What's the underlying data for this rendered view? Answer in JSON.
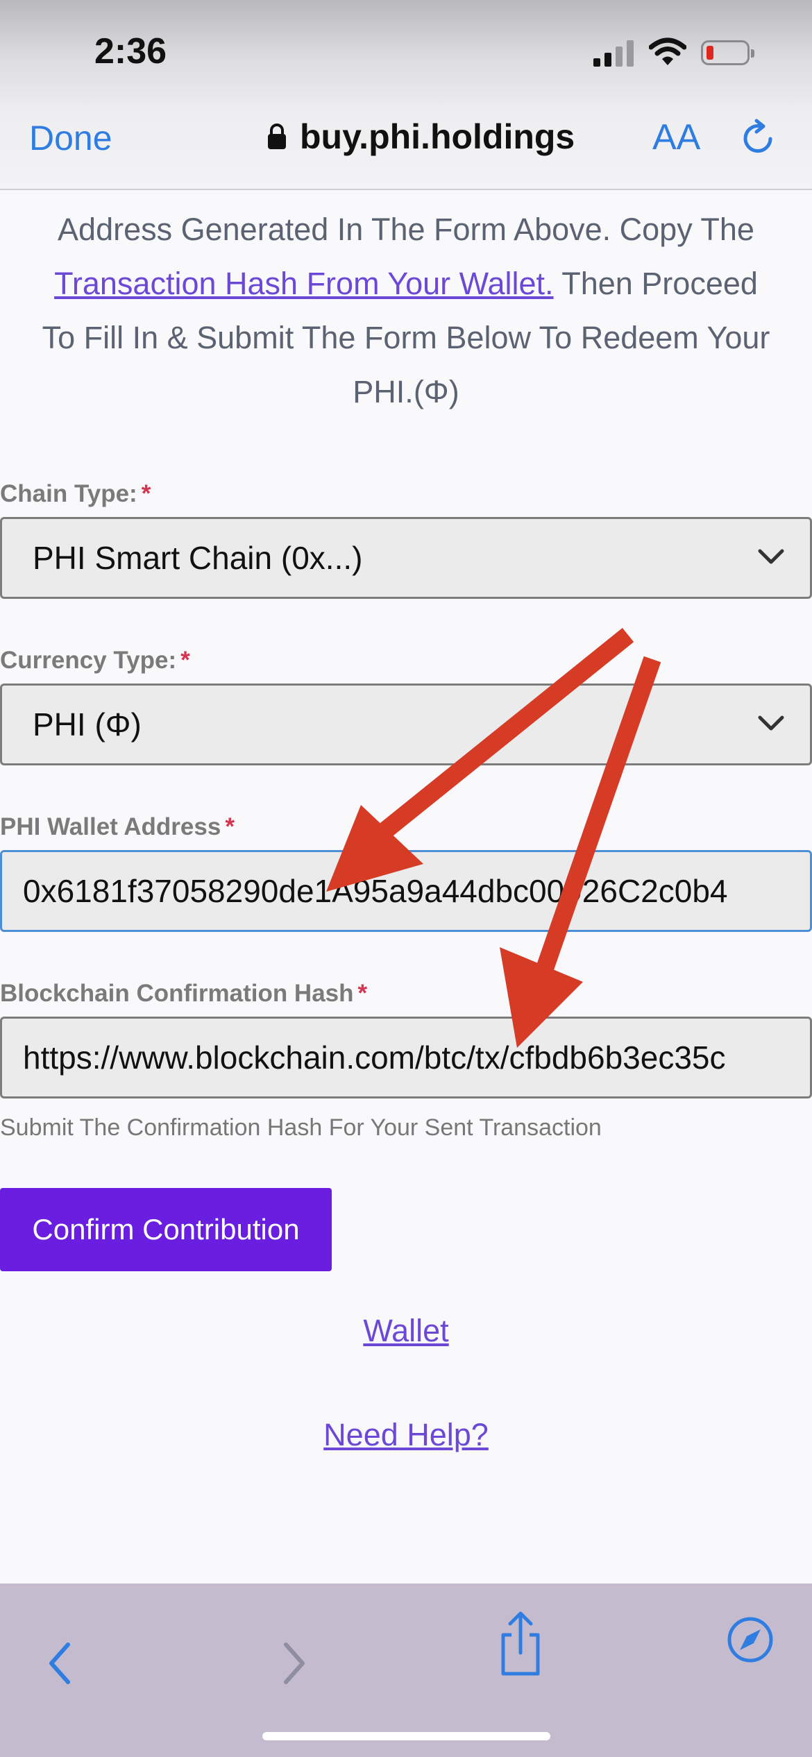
{
  "status_bar": {
    "time": "2:36"
  },
  "browser": {
    "done_label": "Done",
    "url": "buy.phi.holdings",
    "text_size_label": "AA"
  },
  "intro": {
    "before_link": "Address Generated In The Form Above. Copy The ",
    "link_text": "Transaction Hash From Your Wallet.",
    "after_link": " Then Proceed To Fill In & Submit The Form Below To Redeem Your PHI.(Φ)"
  },
  "form": {
    "required_mark": "*",
    "chain_type": {
      "label": "Chain Type:",
      "value": "PHI Smart Chain (0x...)"
    },
    "currency_type": {
      "label": "Currency Type:",
      "value": "PHI (Φ)"
    },
    "wallet_address": {
      "label": "PHI Wallet Address",
      "value": "0x6181f37058290de1A95a9a44dbc00926C2c0b4"
    },
    "confirmation_hash": {
      "label": "Blockchain Confirmation Hash",
      "value": "https://www.blockchain.com/btc/tx/cfbdb6b3ec35c",
      "hint": "Submit The Confirmation Hash For Your Sent Transaction"
    },
    "submit_label": "Confirm Contribution"
  },
  "links": {
    "wallet": "Wallet",
    "help": "Need Help?"
  },
  "colors": {
    "accent": "#6a1ee0",
    "link": "#6b49d6",
    "safari_blue": "#2f7de1",
    "annotation_arrow": "#d63b26"
  }
}
